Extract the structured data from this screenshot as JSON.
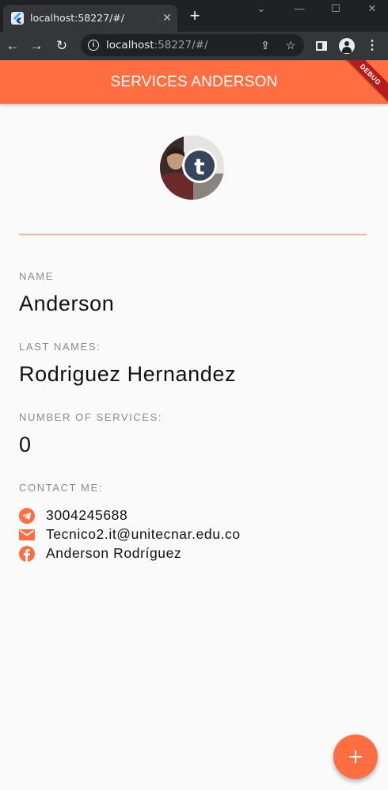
{
  "colors": {
    "accent": "#ff6e40",
    "divider": "#f5b59a",
    "accent_dark": "#e64a19"
  },
  "browser": {
    "tab_title": "localhost:58227/#/",
    "url_host": "localhost",
    "url_rest": ":58227/#/",
    "icons": [
      "flutter-favicon",
      "close-icon",
      "plus-icon",
      "back-arrow-icon",
      "forward-arrow-icon",
      "reload-icon",
      "info-icon",
      "share-icon",
      "star-icon",
      "side-panel-icon",
      "profile-icon",
      "kebab-menu-icon"
    ]
  },
  "appbar": {
    "title": "SERVICES ANDERSON",
    "debug": "DEBUG"
  },
  "profile": {
    "name_label": "NAME",
    "name": "Anderson",
    "last_names_label": "LAST NAMES:",
    "last_names": "Rodriguez Hernandez",
    "services_label": "NUMBER OF SERVICES:",
    "services_count": "0",
    "contact_label": "CONTACT ME:"
  },
  "contacts": [
    {
      "icon": "telegram-icon",
      "text": "3004245688"
    },
    {
      "icon": "email-icon",
      "text": "Tecnico2.it@unitecnar.edu.co"
    },
    {
      "icon": "facebook-icon",
      "text": "Anderson Rodríguez"
    }
  ],
  "fab": {
    "icon": "plus-icon"
  }
}
